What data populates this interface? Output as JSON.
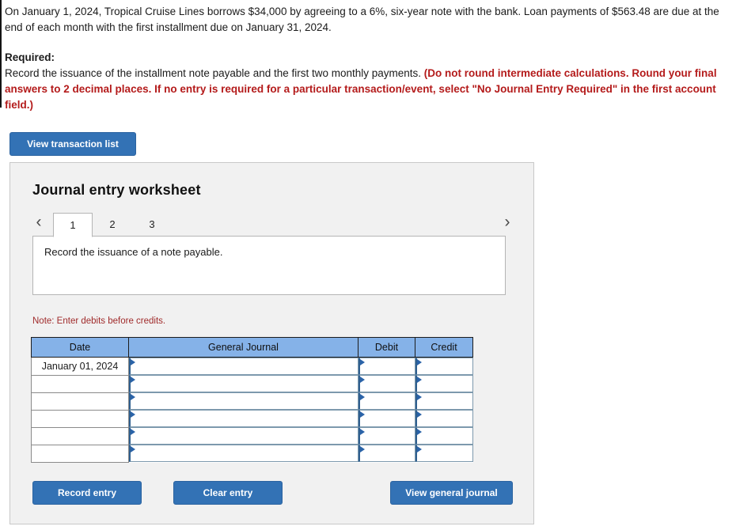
{
  "problem": {
    "paragraph1": "On January 1, 2024, Tropical Cruise Lines borrows $34,000 by agreeing to a 6%, six-year note with the bank. Loan payments of $563.48 are due at the end of each month with the first installment due on January 31, 2024.",
    "required_label": "Required:",
    "required_text_plain": "Record the issuance of the installment note payable and the first two monthly payments. ",
    "required_text_emphasis": "(Do not round intermediate calculations. Round your final answers to 2 decimal places. If no entry is required for a particular transaction/event, select \"No Journal Entry Required\" in the first account field.)"
  },
  "toolbar": {
    "view_transaction_list_label": "View transaction list"
  },
  "worksheet": {
    "title": "Journal entry worksheet",
    "nav": {
      "prev_icon": "chevron-left-icon",
      "next_icon": "chevron-right-icon",
      "prev_glyph": "‹",
      "next_glyph": "›"
    },
    "tabs": [
      {
        "label": "1",
        "active": true
      },
      {
        "label": "2",
        "active": false
      },
      {
        "label": "3",
        "active": false
      }
    ],
    "active_tab_description": "Record the issuance of a note payable.",
    "note": "Note: Enter debits before credits.",
    "table": {
      "headers": [
        "Date",
        "General Journal",
        "Debit",
        "Credit"
      ],
      "rows": [
        {
          "date": "January 01, 2024",
          "general_journal": "",
          "debit": "",
          "credit": ""
        },
        {
          "date": "",
          "general_journal": "",
          "debit": "",
          "credit": ""
        },
        {
          "date": "",
          "general_journal": "",
          "debit": "",
          "credit": ""
        },
        {
          "date": "",
          "general_journal": "",
          "debit": "",
          "credit": ""
        },
        {
          "date": "",
          "general_journal": "",
          "debit": "",
          "credit": ""
        },
        {
          "date": "",
          "general_journal": "",
          "debit": "",
          "credit": ""
        }
      ]
    },
    "buttons": {
      "record_entry": "Record entry",
      "clear_entry": "Clear entry",
      "view_general_journal": "View general journal"
    }
  },
  "colors": {
    "button_blue": "#3372b5",
    "table_header_blue": "#85b2e8",
    "emphasis_red": "#b41b1b",
    "note_red": "#a02b2b",
    "panel_gray": "#f1f1f1"
  }
}
